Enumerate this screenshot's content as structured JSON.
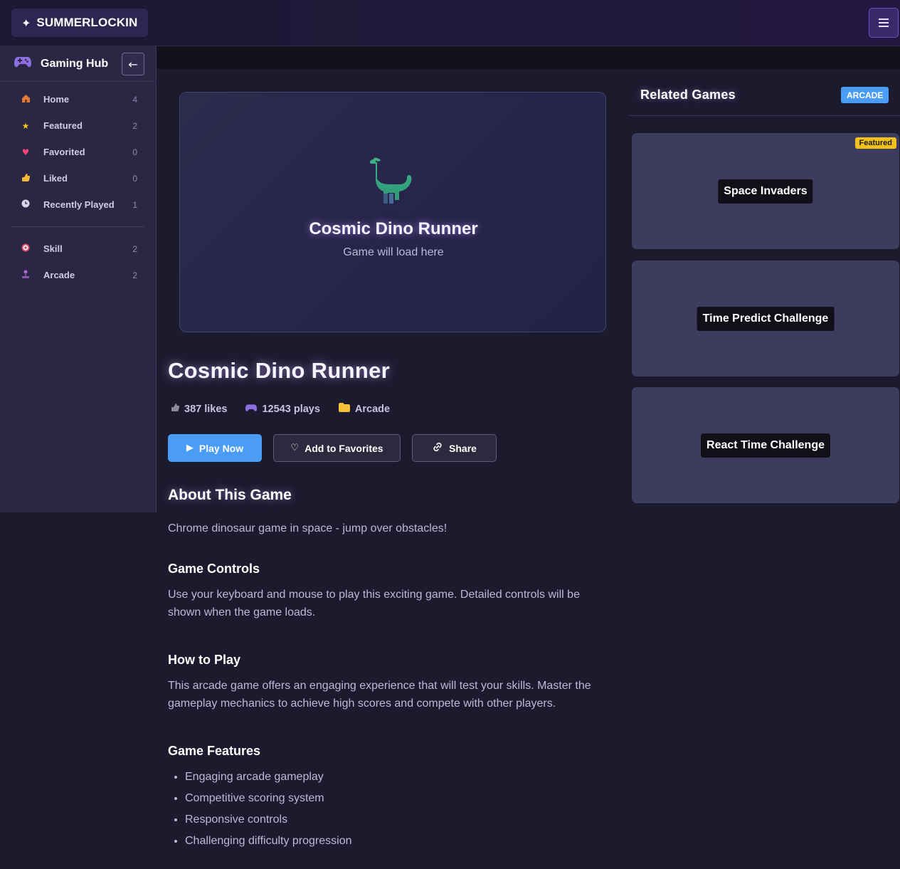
{
  "header": {
    "brand_icon": "sparkle-icon",
    "brand_name": "SUMMERLOCKIN",
    "menu_icon": "hamburger-menu-icon"
  },
  "sidebar": {
    "title": "Gaming Hub",
    "title_icon": "gamepad-icon",
    "collapse_icon": "arrow-left-icon",
    "items": [
      {
        "label": "Home",
        "count": "4",
        "icon": "house-icon"
      },
      {
        "label": "Featured",
        "count": "2",
        "icon": "star-icon"
      },
      {
        "label": "Favorited",
        "count": "0",
        "icon": "heart-icon"
      },
      {
        "label": "Liked",
        "count": "0",
        "icon": "thumbs-up-icon"
      },
      {
        "label": "Recently Played",
        "count": "1",
        "icon": "clock-icon"
      }
    ],
    "categories": [
      {
        "label": "Skill",
        "count": "2",
        "icon": "target-icon"
      },
      {
        "label": "Arcade",
        "count": "2",
        "icon": "joystick-icon"
      }
    ]
  },
  "game": {
    "frame_title": "Cosmic Dino Runner",
    "frame_subtitle": "Game will load here",
    "title": "Cosmic Dino Runner",
    "likes": "387 likes",
    "plays": "12543 plays",
    "category": "Arcade",
    "buttons": {
      "play": "Play Now",
      "favorite": "Add to Favorites",
      "share": "Share"
    }
  },
  "about": {
    "heading": "About This Game",
    "description": "Chrome dinosaur game in space - jump over obstacles!",
    "controls_heading": "Game Controls",
    "controls_text": "Use your keyboard and mouse to play this exciting game. Detailed controls will be shown when the game loads.",
    "howto_heading": "How to Play",
    "howto_text": "This arcade game offers an engaging experience that will test your skills. Master the gameplay mechanics to achieve high scores and compete with other players.",
    "features_heading": "Game Features",
    "features": [
      "Engaging arcade gameplay",
      "Competitive scoring system",
      "Responsive controls",
      "Challenging difficulty progression"
    ]
  },
  "related": {
    "title": "Related Games",
    "badge": "ARCADE",
    "games": [
      {
        "title": "Space Invaders",
        "badge": "Featured"
      },
      {
        "title": "Time Predict Challenge",
        "badge": ""
      },
      {
        "title": "React Time Challenge",
        "badge": ""
      }
    ]
  },
  "colors": {
    "accent": "#4a9cf5",
    "background": "#1c1b2e",
    "sidebar": "#2a2745",
    "card": "#3d3b5e",
    "featured_badge": "#f2c21a"
  }
}
